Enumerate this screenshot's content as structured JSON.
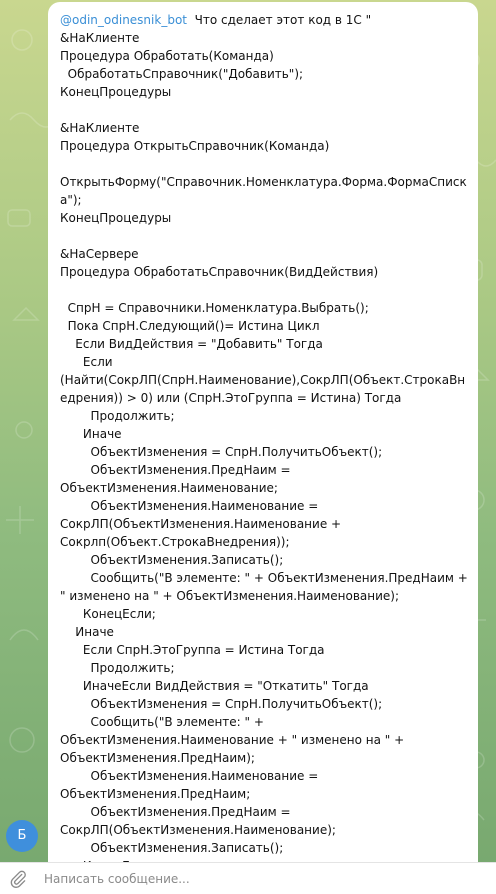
{
  "message": {
    "mention": "@odin_odinesnik_bot",
    "text": "  Что сделает этот код в 1С \"\n&НаКлиенте\nПроцедура Обработать(Команда)\n  ОбработатьСправочник(\"Добавить\");\nКонецПроцедуры\n\n&НаКлиенте\nПроцедура ОткрытьСправочник(Команда)\n\nОткрытьФорму(\"Справочник.Номенклатура.Форма.ФормаСписка\");\nКонецПроцедуры\n\n&НаСервере\nПроцедура ОбработатьСправочник(ВидДействия)\n\n  СпрН = Справочники.Номенклатура.Выбрать();\n  Пока СпрН.Следующий()= Истина Цикл\n    Если ВидДействия = \"Добавить\" Тогда\n      Если\n(Найти(СокрЛП(СпрН.Наименование),СокрЛП(Объект.СтрокаВнедрения)) > 0) или (СпрН.ЭтоГруппа = Истина) Тогда\n        Продолжить;\n      Иначе\n        ОбъектИзменения = СпрН.ПолучитьОбъект();\n        ОбъектИзменения.ПредНаим =\nОбъектИзменения.Наименование;\n        ОбъектИзменения.Наименование =\nСокрЛП(ОбъектИзменения.Наименование +\nСокрлп(Объект.СтрокаВнедрения));\n        ОбъектИзменения.Записать();\n        Сообщить(\"В элементе: \" + ОбъектИзменения.ПредНаим + \" изменено на \" + ОбъектИзменения.Наименование);\n      КонецЕсли;\n    Иначе\n      Если СпрН.ЭтоГруппа = Истина Тогда\n        Продолжить;\n      ИначеЕсли ВидДействия = \"Откатить\" Тогда\n        ОбъектИзменения = СпрН.ПолучитьОбъект();\n        Сообщить(\"В элементе: \" +\nОбъектИзменения.Наименование + \" изменено на \" +\nОбъектИзменения.ПредНаим);\n        ОбъектИзменения.Наименование =\nОбъектИзменения.ПредНаим;\n        ОбъектИзменения.ПредНаим =\nСокрЛП(ОбъектИзменения.Наименование);\n        ОбъектИзменения.Записать();\n      КонецЕсли;"
  },
  "avatar": {
    "letter": "Б",
    "color": "#3f8fdc"
  },
  "composer": {
    "placeholder": "Написать сообщение...",
    "value": ""
  },
  "icons": {
    "attach": "paperclip-icon"
  },
  "colors": {
    "mention": "#3a8fd6",
    "bubble": "#ffffff",
    "text": "#111111"
  }
}
